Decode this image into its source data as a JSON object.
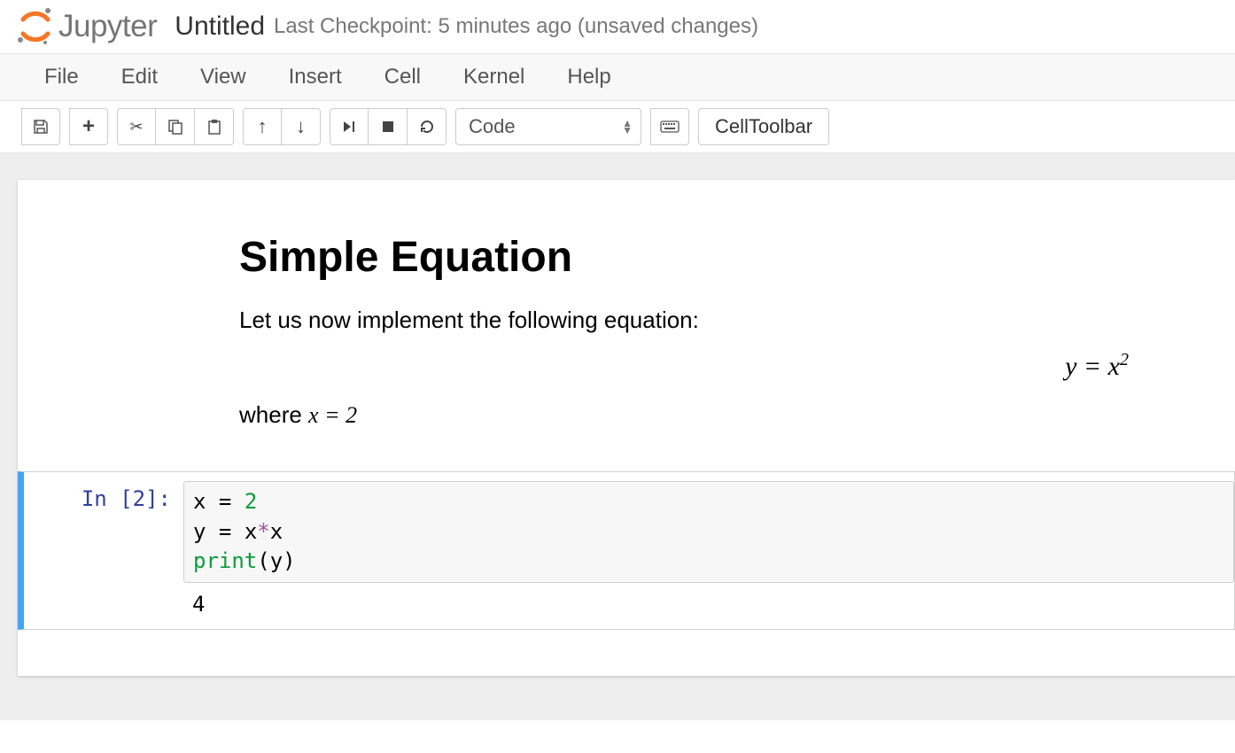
{
  "header": {
    "brand": "Jupyter",
    "notebook_name": "Untitled",
    "checkpoint": "Last Checkpoint: 5 minutes ago (unsaved changes)"
  },
  "menu": [
    "File",
    "Edit",
    "View",
    "Insert",
    "Cell",
    "Kernel",
    "Help"
  ],
  "toolbar": {
    "cell_type": "Code",
    "cell_toolbar_label": "CellToolbar"
  },
  "markdown": {
    "heading": "Simple Equation",
    "intro": "Let us now implement the following equation:",
    "equation": "y = x²",
    "where_prefix": "where ",
    "where_math": "x = 2"
  },
  "codecell": {
    "prompt": "In [2]:",
    "line1_var": "x",
    "line1_eq": " = ",
    "line1_num": "2",
    "line2_var": "y",
    "line2_eq": " = ",
    "line2_rhs_x1": "x",
    "line2_star": "*",
    "line2_rhs_x2": "x",
    "line3_func": "print",
    "line3_open": "(",
    "line3_arg": "y",
    "line3_close": ")",
    "output": "4"
  }
}
